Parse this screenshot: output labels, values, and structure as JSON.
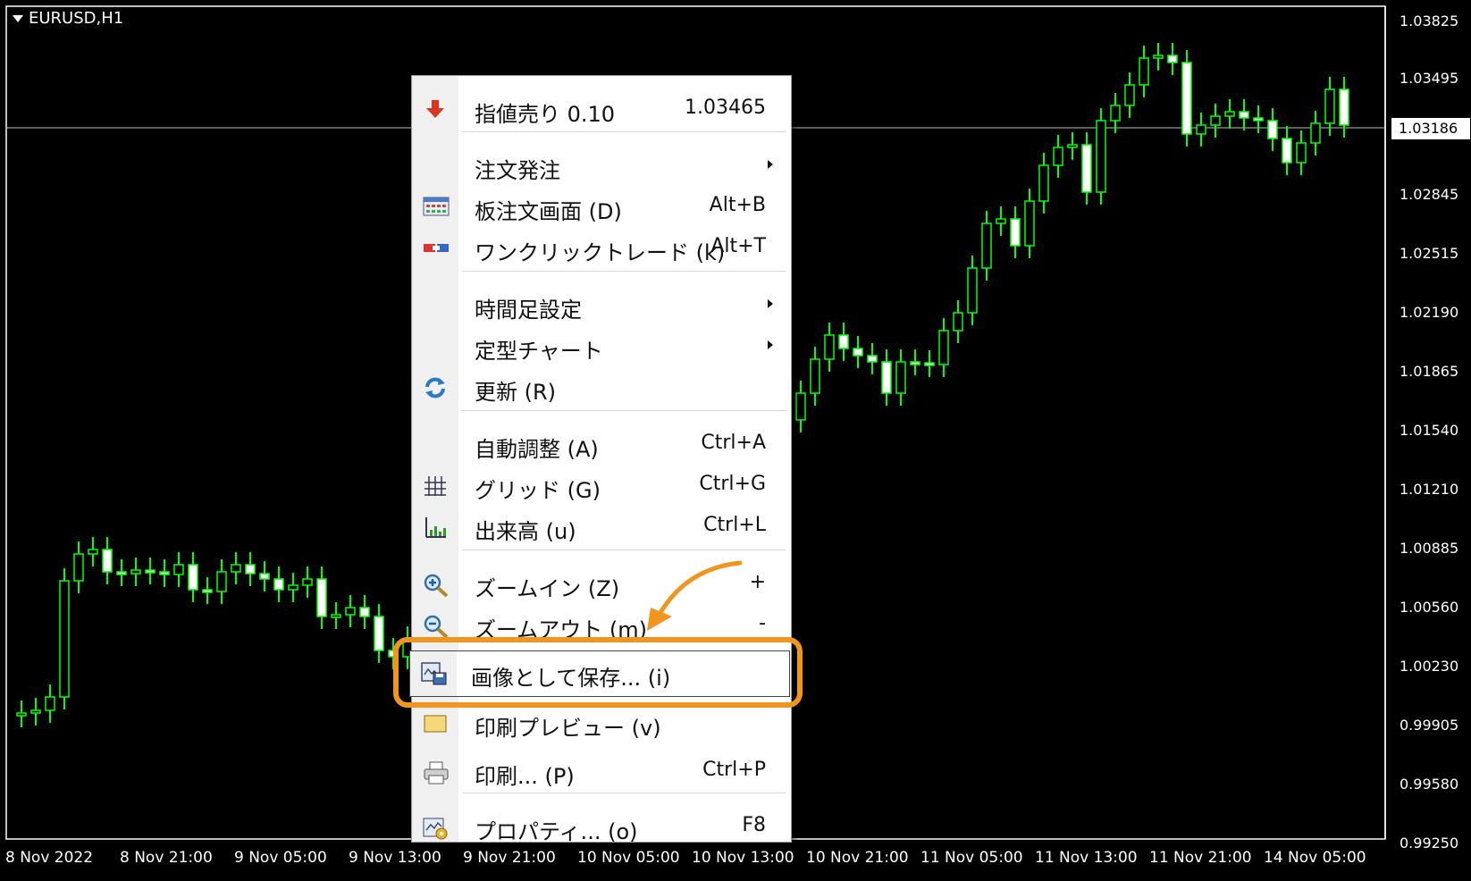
{
  "chart": {
    "symbol": "EURUSD,H1",
    "current_price": "1.03186",
    "y_axis_labels": [
      "1.03825",
      "1.03495",
      "1.03186",
      "1.02845",
      "1.02515",
      "1.02190",
      "1.01865",
      "1.01540",
      "1.01210",
      "1.00885",
      "1.00560",
      "1.00230",
      "0.99905",
      "0.99580",
      "0.99250"
    ],
    "x_axis_labels": [
      "8 Nov 2022",
      "8 Nov 21:00",
      "9 Nov 05:00",
      "9 Nov 13:00",
      "9 Nov 21:00",
      "10 Nov 05:00",
      "10 Nov 13:00",
      "10 Nov 21:00",
      "11 Nov 05:00",
      "11 Nov 13:00",
      "11 Nov 21:00",
      "14 Nov 05:00"
    ],
    "colors": {
      "background": "#000000",
      "candle": "#00ff00",
      "bull_body": "#000000",
      "bear_body": "#ffffff",
      "price_line": "#c0c0c0"
    }
  },
  "context_menu": {
    "items": [
      {
        "name": "sell-limit",
        "icon": "sell-arrow-icon",
        "label": "指値売り 0.10",
        "shortcut": "1.03465"
      },
      {
        "name": "new-order",
        "icon": "",
        "label": "注文発注",
        "submenu": true
      },
      {
        "name": "order-board",
        "icon": "order-board-icon",
        "label": "板注文画面 (D)",
        "shortcut": "Alt+B"
      },
      {
        "name": "one-click-trade",
        "icon": "one-click-icon",
        "label": "ワンクリックトレード (k)",
        "shortcut": "Alt+T"
      },
      {
        "name": "timeframe",
        "icon": "",
        "label": "時間足設定",
        "submenu": true
      },
      {
        "name": "template",
        "icon": "",
        "label": "定型チャート",
        "submenu": true
      },
      {
        "name": "refresh",
        "icon": "refresh-icon",
        "label": "更新 (R)",
        "shortcut": ""
      },
      {
        "name": "auto-scroll",
        "icon": "",
        "label": "自動調整 (A)",
        "shortcut": "Ctrl+A"
      },
      {
        "name": "grid",
        "icon": "grid-icon",
        "label": "グリッド (G)",
        "shortcut": "Ctrl+G"
      },
      {
        "name": "volumes",
        "icon": "volumes-icon",
        "label": "出来高 (u)",
        "shortcut": "Ctrl+L"
      },
      {
        "name": "zoom-in",
        "icon": "zoom-in-icon",
        "label": "ズームイン (Z)",
        "shortcut": "+"
      },
      {
        "name": "zoom-out",
        "icon": "zoom-out-icon",
        "label": "ズームアウト (m)",
        "shortcut": "-"
      },
      {
        "name": "save-as-picture",
        "icon": "save-picture-icon",
        "label": "画像として保存... (i)",
        "shortcut": ""
      },
      {
        "name": "print-preview",
        "icon": "print-preview-icon",
        "label": "印刷プレビュー (v)",
        "shortcut": ""
      },
      {
        "name": "print",
        "icon": "printer-icon",
        "label": "印刷... (P)",
        "shortcut": "Ctrl+P"
      },
      {
        "name": "properties",
        "icon": "properties-icon",
        "label": "プロパティ... (o)",
        "shortcut": "F8"
      }
    ]
  },
  "annotation": {
    "highlight_color": "#f0961e"
  }
}
